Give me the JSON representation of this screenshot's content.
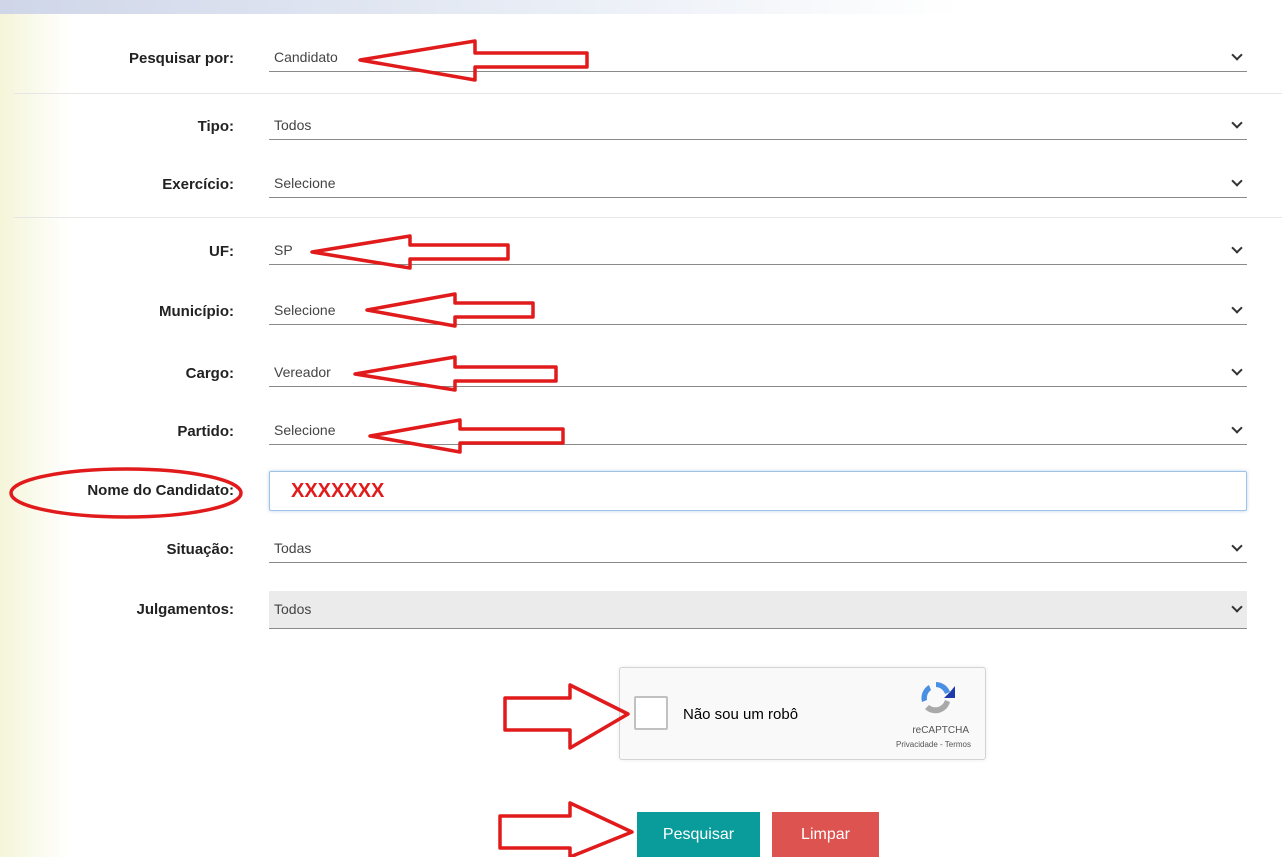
{
  "form": {
    "pesquisar_por": {
      "label": "Pesquisar por:",
      "value": "Candidato"
    },
    "tipo": {
      "label": "Tipo:",
      "value": "Todos"
    },
    "exercicio": {
      "label": "Exercício:",
      "value": "Selecione"
    },
    "uf": {
      "label": "UF:",
      "value": "SP"
    },
    "municipio": {
      "label": "Município:",
      "value": "Selecione"
    },
    "cargo": {
      "label": "Cargo:",
      "value": "Vereador"
    },
    "partido": {
      "label": "Partido:",
      "value": "Selecione"
    },
    "nome_candidato": {
      "label": "Nome do Candidato:",
      "value": "XXXXXXX"
    },
    "situacao": {
      "label": "Situação:",
      "value": "Todas"
    },
    "julgamentos": {
      "label": "Julgamentos:",
      "value": "Todos"
    }
  },
  "recaptcha": {
    "label": "Não sou um robô",
    "brand": "reCAPTCHA",
    "links": "Privacidade - Termos",
    "icon": "recaptcha-logo-icon"
  },
  "buttons": {
    "search_label": "Pesquisar",
    "clear_label": "Limpar"
  },
  "colors": {
    "search_button": "#0a9c9a",
    "clear_button": "#dc5350",
    "annotation": "#e11b1b"
  }
}
